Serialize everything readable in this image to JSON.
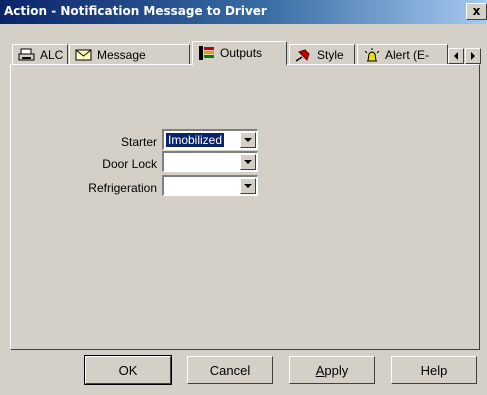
{
  "window": {
    "title": "Action - Notification Message to Driver",
    "close_label": "x"
  },
  "tabs": [
    {
      "label": "ALC",
      "icon": "printer-icon",
      "active": false
    },
    {
      "label": "Message",
      "icon": "envelope-icon",
      "active": false
    },
    {
      "label": "Outputs",
      "icon": "outputs-icon",
      "active": true
    },
    {
      "label": "Style",
      "icon": "pushpin-icon",
      "active": false
    },
    {
      "label": "Alert (E-",
      "icon": "alert-light-icon",
      "active": false
    }
  ],
  "tab_scroll": {
    "left_icon": "arrow-left-icon",
    "right_icon": "arrow-right-icon"
  },
  "fields": [
    {
      "label": "Starter",
      "value": "Imobilized",
      "selected": true
    },
    {
      "label": "Door Lock",
      "value": ""
    },
    {
      "label": "Refrigeration",
      "value": ""
    }
  ],
  "buttons": {
    "ok": "OK",
    "cancel": "Cancel",
    "apply": "Apply",
    "help": "Help"
  },
  "colors": {
    "title_gradient_start": "#0a246a",
    "title_gradient_end": "#a6caf0",
    "dialog_face": "#d4d0c8",
    "selection": "#0a246a"
  }
}
